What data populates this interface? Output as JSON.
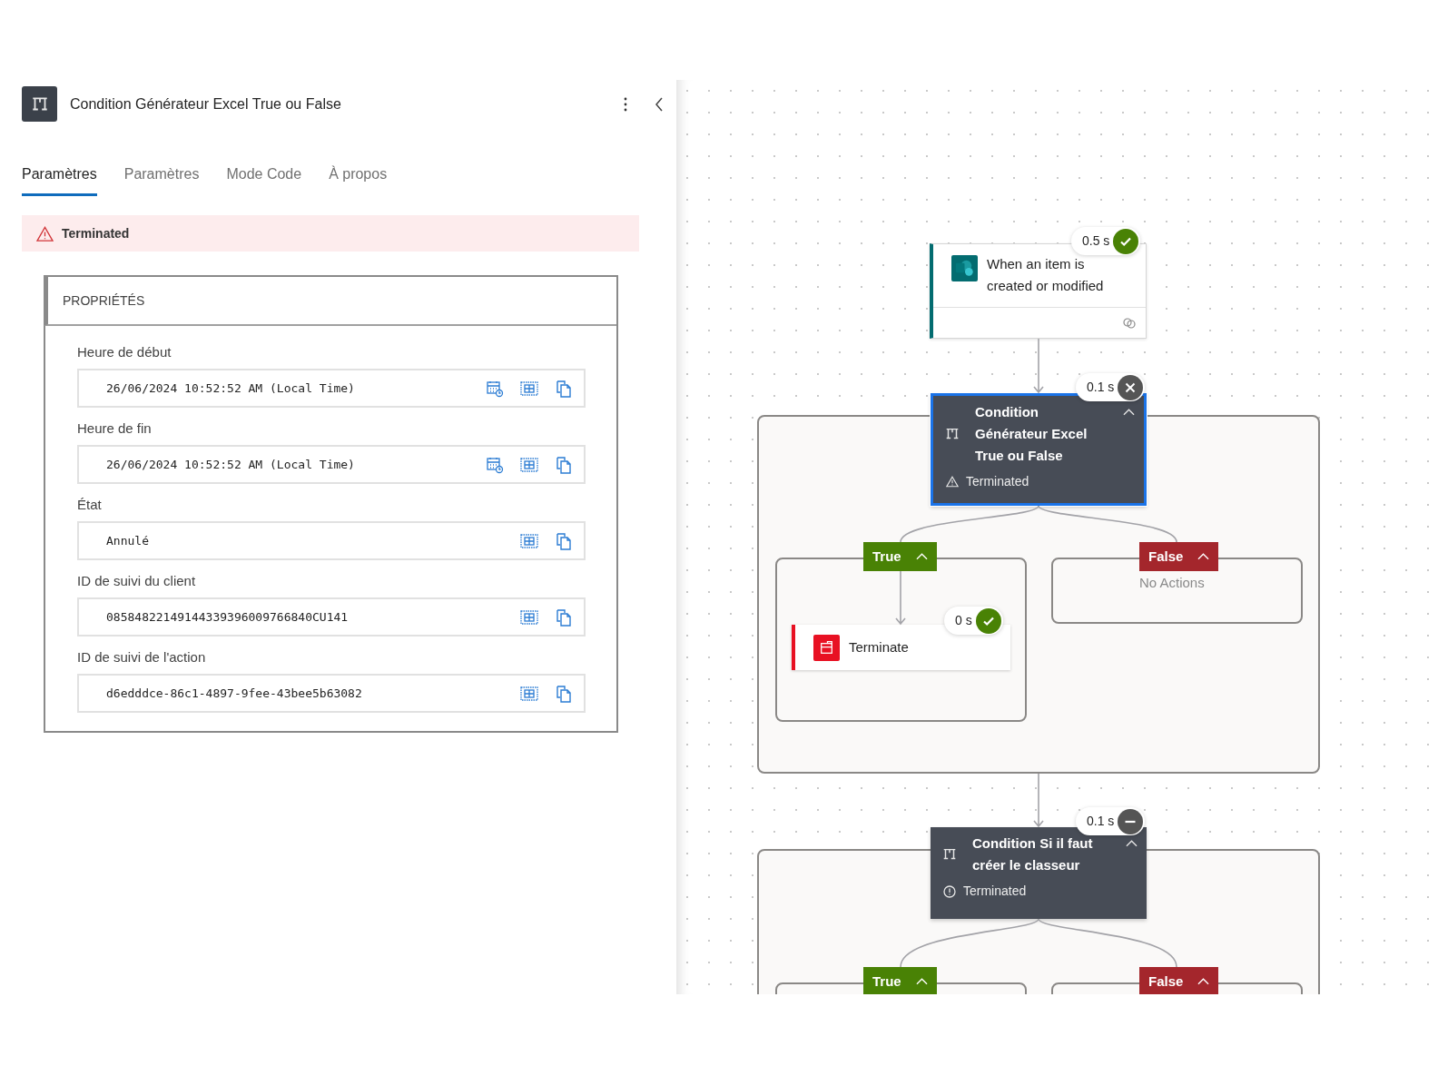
{
  "panel": {
    "title": "Condition Générateur Excel True ou False",
    "tabs": [
      {
        "label": "Paramètres",
        "selected": true
      },
      {
        "label": "Paramètres",
        "selected": false
      },
      {
        "label": "Mode Code",
        "selected": false
      },
      {
        "label": "À propos",
        "selected": false
      }
    ],
    "alert": {
      "text": "Terminated"
    },
    "section": {
      "title": "PROPRIÉTÉS",
      "fields": [
        {
          "label": "Heure de début",
          "value": "26/06/2024 10:52:52 AM (Local Time)",
          "kind": "datetime"
        },
        {
          "label": "Heure de fin",
          "value": "26/06/2024 10:52:52 AM (Local Time)",
          "kind": "datetime"
        },
        {
          "label": "État",
          "value": "Annulé",
          "kind": "text"
        },
        {
          "label": "ID de suivi du client",
          "value": "08584822149144339396009766840CU141",
          "kind": "text"
        },
        {
          "label": "ID de suivi de l'action",
          "value": "d6edddce-86c1-4897-9fee-43bee5b63082",
          "kind": "text"
        }
      ]
    }
  },
  "canvas": {
    "trigger": {
      "title": "When an item is created or modified",
      "run": {
        "duration": "0.5 s",
        "kind": "succeeded"
      }
    },
    "conditions": [
      {
        "title": "Condition Générateur Excel True ou False",
        "run": {
          "duration": "0.1 s",
          "kind": "failed"
        },
        "selected": true,
        "expanded": true,
        "message": "Terminated",
        "branches": [
          {
            "label": "True",
            "kind": "true",
            "expanded": true,
            "actions": [
              {
                "title": "Terminate",
                "run": {
                  "duration": "0 s",
                  "kind": "succeeded"
                }
              }
            ]
          },
          {
            "label": "False",
            "kind": "false",
            "expanded": true,
            "empty_text": "No Actions"
          }
        ]
      },
      {
        "title": "Condition Si il faut créer le classeur",
        "run": {
          "duration": "0.1 s",
          "kind": "skipped"
        },
        "selected": false,
        "expanded": true,
        "message": "Terminated",
        "branches": [
          {
            "label": "True",
            "kind": "true",
            "expanded": true
          },
          {
            "label": "False",
            "kind": "false",
            "expanded": true
          }
        ]
      }
    ]
  }
}
